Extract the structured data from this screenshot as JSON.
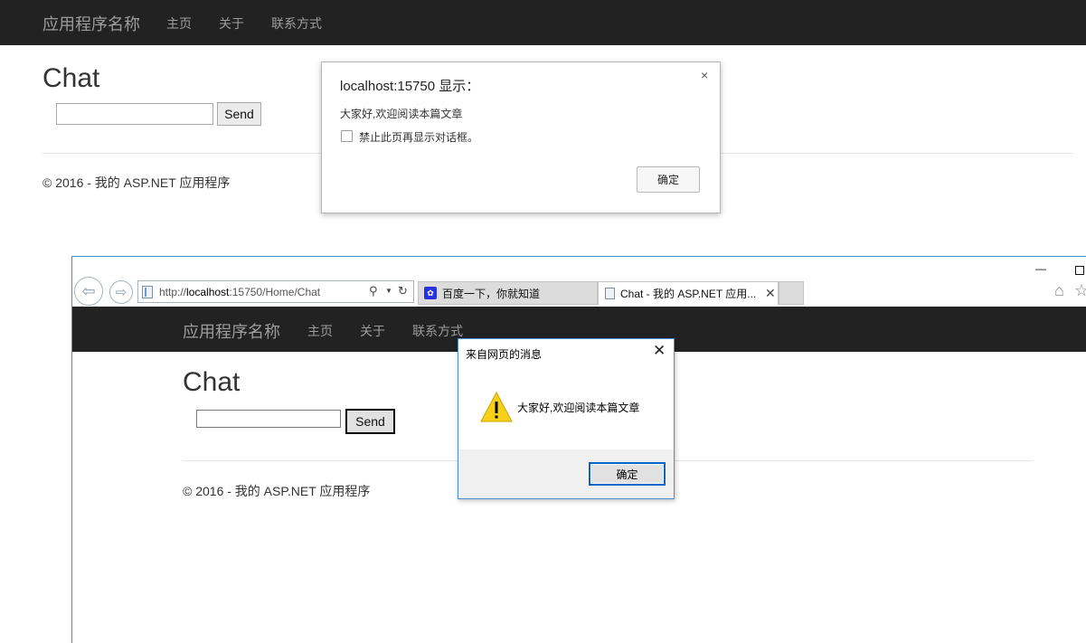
{
  "chrome_page": {
    "navbar": {
      "brand": "应用程序名称",
      "links": [
        "主页",
        "关于",
        "联系方式"
      ]
    },
    "title": "Chat",
    "message_input": {
      "value": "",
      "placeholder": ""
    },
    "send_label": "Send",
    "footer": "© 2016 - 我的 ASP.NET 应用程序"
  },
  "chrome_dialog": {
    "title": "localhost:15750 显示：",
    "close": "×",
    "message": "大家好,欢迎阅读本篇文章",
    "checkbox_label": "禁止此页再显示对话框。",
    "ok_label": "确定"
  },
  "ie_window": {
    "controls": {
      "minimize": "—"
    },
    "address": {
      "prefix": "http://",
      "host": "localhost",
      "rest": ":15750/Home/Chat"
    },
    "tabs": [
      {
        "label": "百度一下，你就知道",
        "icon": "baidu-icon",
        "active": false
      },
      {
        "label": "Chat - 我的 ASP.NET 应用...",
        "icon": "page-icon",
        "active": true,
        "close": "✕"
      }
    ],
    "page": {
      "navbar": {
        "brand": "应用程序名称",
        "links": [
          "主页",
          "关于",
          "联系方式"
        ]
      },
      "title": "Chat",
      "message_input": {
        "value": "",
        "placeholder": ""
      },
      "send_label": "Send",
      "footer": "© 2016 - 我的 ASP.NET 应用程序"
    },
    "dialog": {
      "title": "来自网页的消息",
      "close": "✕",
      "message": "大家好,欢迎阅读本篇文章",
      "ok_label": "确定",
      "icon": "warning-icon"
    }
  },
  "colors": {
    "navbar_bg": "#222222",
    "navbar_text": "#9d9d9d",
    "ie_accent": "#3b8ed6",
    "warning_yellow": "#f7d117"
  }
}
